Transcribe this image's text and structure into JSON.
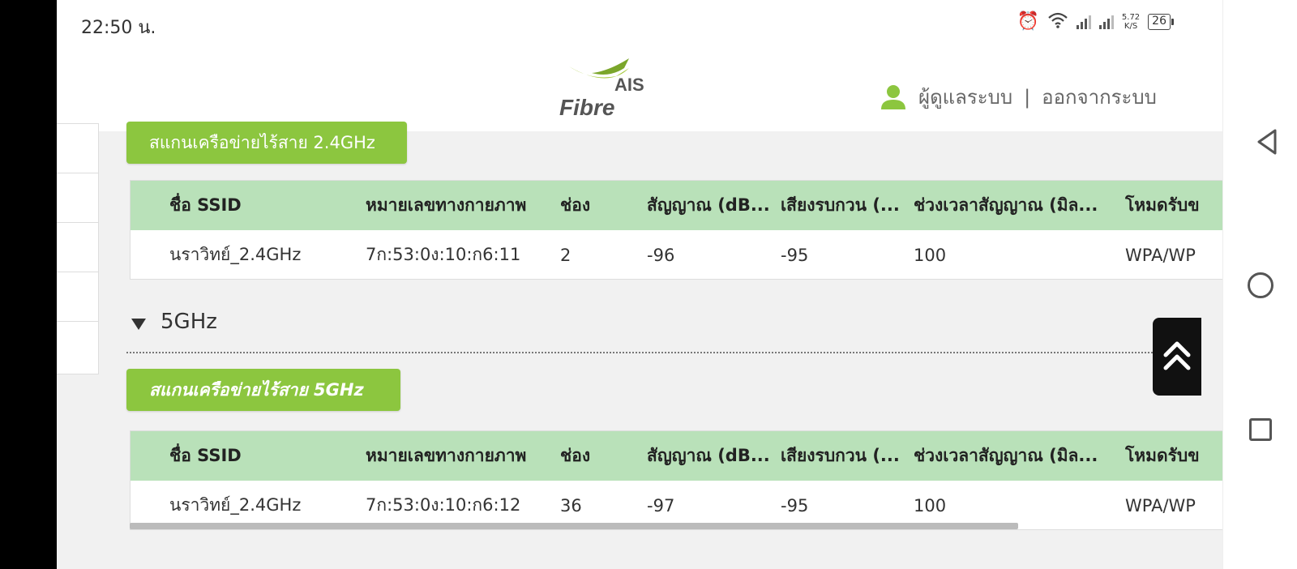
{
  "status_bar": {
    "time": "22:50 น.",
    "speed_value": "5.72",
    "speed_unit": "K/S",
    "battery": "26"
  },
  "header": {
    "logo_top": "AIS",
    "logo_bottom": "Fibre",
    "user_name": "ผู้ดูแลระบบ",
    "separator": "|",
    "logout": "ออกจากระบบ"
  },
  "band_24": {
    "scan_button": "สแกนเครือข่ายไร้สาย 2.4GHz",
    "columns": [
      "ชื่อ SSID",
      "หมายเลขทางกายภาพ",
      "ช่อง",
      "สัญญาณ (dB...",
      "เสียงรบกวน (...",
      "ช่วงเวลาสัญญาณ (มิล...",
      "โหมดรับข"
    ],
    "rows": [
      [
        "นราวิทย์_2.4GHz",
        "7ก:53:0ง:10:ก6:11",
        "2",
        "-96",
        "-95",
        "100",
        "WPA/WP"
      ]
    ]
  },
  "band_5": {
    "section_title": "5GHz",
    "scan_button": "สแกนเครือข่ายไร้สาย 5GHz",
    "columns": [
      "ชื่อ SSID",
      "หมายเลขทางกายภาพ",
      "ช่อง",
      "สัญญาณ (dB...",
      "เสียงรบกวน (...",
      "ช่วงเวลาสัญญาณ (มิล...",
      "โหมดรับข"
    ],
    "rows": [
      [
        "นราวิทย์_2.4GHz",
        "7ก:53:0ง:10:ก6:12",
        "36",
        "-97",
        "-95",
        "100",
        "WPA/WP"
      ]
    ]
  },
  "colors": {
    "brand_green": "#8cc63f",
    "table_header_green": "#b9e1b9"
  }
}
